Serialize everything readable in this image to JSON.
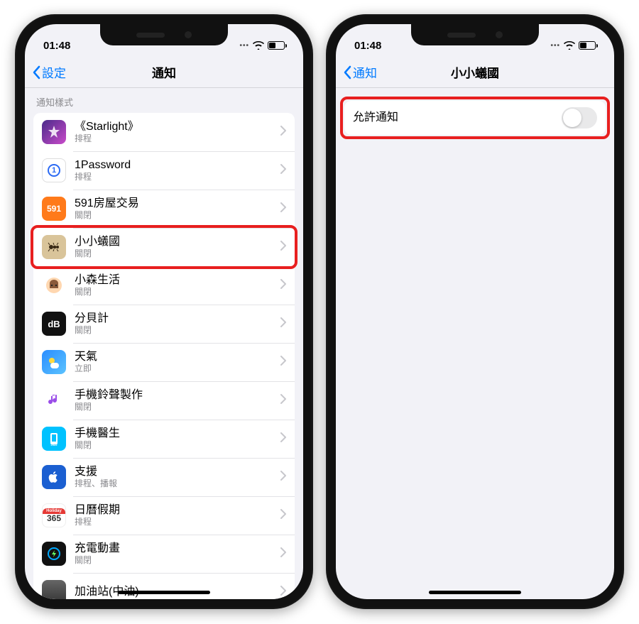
{
  "status": {
    "time": "01:48"
  },
  "left": {
    "back_label": "設定",
    "title": "通知",
    "section_header": "通知樣式",
    "apps": [
      {
        "name": "《Starlight》",
        "sub": "排程",
        "icon": "starlight"
      },
      {
        "name": "1Password",
        "sub": "排程",
        "icon": "1pw"
      },
      {
        "name": "591房屋交易",
        "sub": "關閉",
        "icon": "591"
      },
      {
        "name": "小小蟻國",
        "sub": "關閉",
        "icon": "ant",
        "highlighted": true
      },
      {
        "name": "小森生活",
        "sub": "關閉",
        "icon": "forest"
      },
      {
        "name": "分貝計",
        "sub": "關閉",
        "icon": "db"
      },
      {
        "name": "天氣",
        "sub": "立即",
        "icon": "weather"
      },
      {
        "name": "手機鈴聲製作",
        "sub": "關閉",
        "icon": "ring"
      },
      {
        "name": "手機醫生",
        "sub": "關閉",
        "icon": "doctor"
      },
      {
        "name": "支援",
        "sub": "排程、播報",
        "icon": "apple"
      },
      {
        "name": "日曆假期",
        "sub": "排程",
        "icon": "cal"
      },
      {
        "name": "充電動畫",
        "sub": "關閉",
        "icon": "charge"
      },
      {
        "name": "加油站(中油)",
        "sub": "",
        "icon": "gas"
      }
    ]
  },
  "right": {
    "back_label": "通知",
    "title": "小小蟻國",
    "allow_label": "允許通知",
    "allow_value": false
  }
}
